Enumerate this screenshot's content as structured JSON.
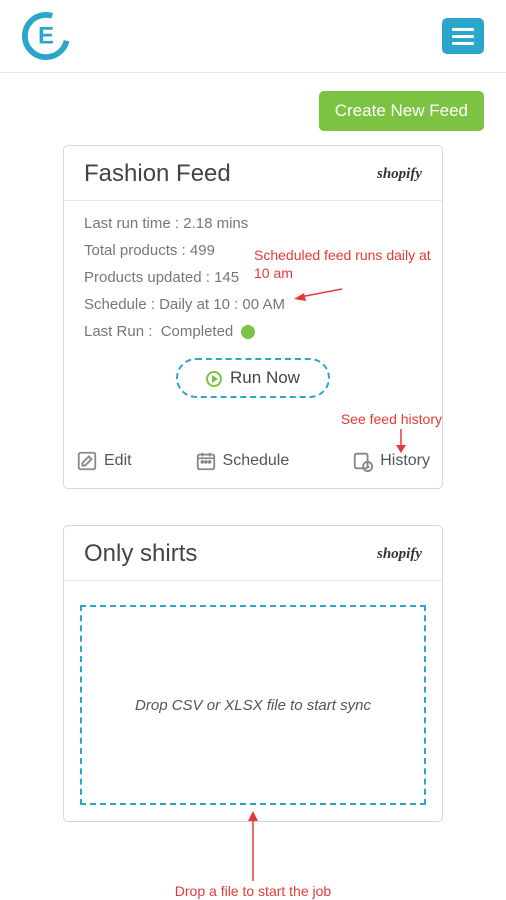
{
  "header": {
    "create_button": "Create New Feed"
  },
  "feed1": {
    "title": "Fashion Feed",
    "platform": "shopify",
    "stats": {
      "last_run_time_label": "Last run time :",
      "last_run_time_value": "2.18 mins",
      "total_products_label": "Total products :",
      "total_products_value": "499",
      "products_updated_label": "Products updated :",
      "products_updated_value": "145",
      "schedule_label": "Schedule :",
      "schedule_value": "Daily at 10 : 00 AM",
      "last_run_label": "Last Run :",
      "last_run_status": "Completed"
    },
    "run_now": "Run Now",
    "actions": {
      "edit": "Edit",
      "schedule": "Schedule",
      "history": "History"
    }
  },
  "feed2": {
    "title": "Only shirts",
    "platform": "shopify",
    "dropzone_text": "Drop CSV or XLSX file to start sync"
  },
  "annotations": {
    "schedule_note": "Scheduled feed runs daily at 10 am",
    "history_note": "See feed history",
    "dropzone_note": "Drop a file to start the job"
  }
}
